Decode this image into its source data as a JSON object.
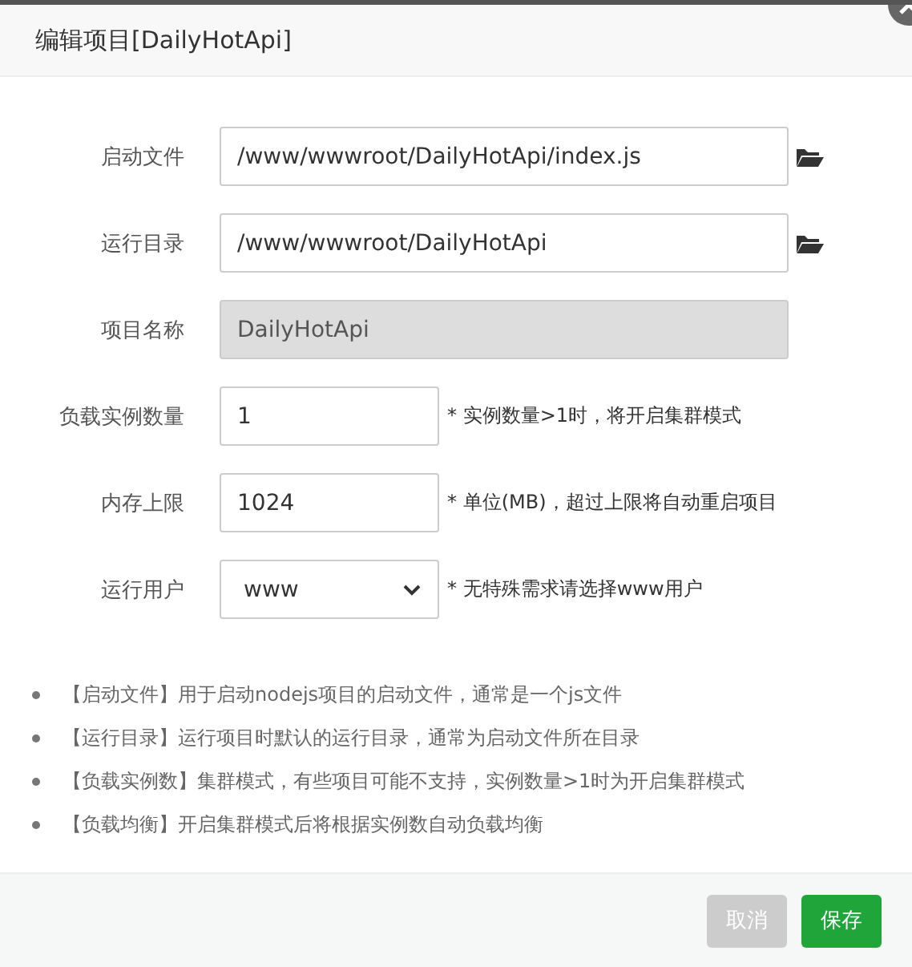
{
  "dialog": {
    "title": "编辑项目[DailyHotApi]"
  },
  "fields": [
    {
      "label": "启动文件",
      "kind": "path",
      "value": "/www/wwwroot/DailyHotApi/index.js"
    },
    {
      "label": "运行目录",
      "kind": "path",
      "value": "/www/wwwroot/DailyHotApi"
    },
    {
      "label": "项目名称",
      "kind": "readonly",
      "value": "DailyHotApi"
    },
    {
      "label": "负载实例数量",
      "kind": "short",
      "value": "1",
      "hint": "* 实例数量>1时，将开启集群模式"
    },
    {
      "label": "内存上限",
      "kind": "short",
      "value": "1024",
      "hint": "* 单位(MB)，超过上限将自动重启项目"
    },
    {
      "label": "运行用户",
      "kind": "select",
      "value": "www",
      "hint": "* 无特殊需求请选择www用户"
    }
  ],
  "notes": [
    "【启动文件】用于启动nodejs项目的启动文件，通常是一个js文件",
    "【运行目录】运行项目时默认的运行目录，通常为启动文件所在目录",
    "【负载实例数】集群模式，有些项目可能不支持，实例数量>1时为开启集群模式",
    "【负载均衡】开启集群模式后将根据实例数自动负载均衡"
  ],
  "buttons": [
    {
      "label": "取消",
      "kind": "cancel"
    },
    {
      "label": "保存",
      "kind": "primary"
    }
  ]
}
